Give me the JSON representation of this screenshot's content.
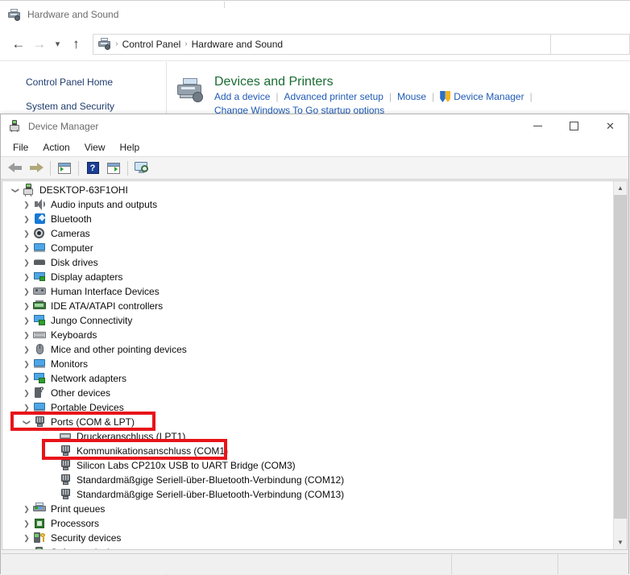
{
  "control_panel": {
    "title": "Hardware and Sound",
    "title_icon": "printer-icon",
    "nav": {
      "back_icon": "arrow-left-icon",
      "forward_icon": "arrow-right-icon",
      "recent_icon": "chevron-down-icon",
      "up_icon": "arrow-up-icon"
    },
    "breadcrumb": {
      "icon": "printer-icon",
      "items": [
        "Control Panel",
        "Hardware and Sound"
      ],
      "separator": "›"
    },
    "search_placeholder": "",
    "left_nav": [
      {
        "label": "Control Panel Home"
      },
      {
        "label": "System and Security"
      }
    ],
    "devices_and_printers": {
      "icon": "printer-icon",
      "heading": "Devices and Printers",
      "links": [
        {
          "label": "Add a device",
          "icon": null
        },
        {
          "label": "Advanced printer setup",
          "icon": null
        },
        {
          "label": "Mouse",
          "icon": null
        },
        {
          "label": "Device Manager",
          "icon": "shield-icon"
        }
      ],
      "extra_link": "Change Windows To Go startup options"
    }
  },
  "device_manager": {
    "title": "Device Manager",
    "title_icon": "device-manager-icon",
    "window_buttons": {
      "minimize": "—",
      "maximize": "□",
      "close": "✕"
    },
    "menu": [
      "File",
      "Action",
      "View",
      "Help"
    ],
    "toolbar": [
      {
        "name": "back-icon"
      },
      {
        "name": "forward-icon"
      },
      {
        "name": "properties-icon"
      },
      {
        "name": "help-icon"
      },
      {
        "name": "update-driver-icon"
      },
      {
        "name": "scan-hardware-changes-icon"
      }
    ],
    "tree": [
      {
        "label": "DESKTOP-63F1OHI",
        "level": 0,
        "twisty": "open",
        "icon": "computer-icon"
      },
      {
        "label": "Audio inputs and outputs",
        "level": 1,
        "twisty": "closed",
        "icon": "speaker-icon"
      },
      {
        "label": "Bluetooth",
        "level": 1,
        "twisty": "closed",
        "icon": "bluetooth-icon"
      },
      {
        "label": "Cameras",
        "level": 1,
        "twisty": "closed",
        "icon": "camera-icon"
      },
      {
        "label": "Computer",
        "level": 1,
        "twisty": "closed",
        "icon": "monitor-icon"
      },
      {
        "label": "Disk drives",
        "level": 1,
        "twisty": "closed",
        "icon": "disk-icon"
      },
      {
        "label": "Display adapters",
        "level": 1,
        "twisty": "closed",
        "icon": "display-adapter-icon"
      },
      {
        "label": "Human Interface Devices",
        "level": 1,
        "twisty": "closed",
        "icon": "hid-icon"
      },
      {
        "label": "IDE ATA/ATAPI controllers",
        "level": 1,
        "twisty": "closed",
        "icon": "ide-controller-icon"
      },
      {
        "label": "Jungo Connectivity",
        "level": 1,
        "twisty": "closed",
        "icon": "network-icon"
      },
      {
        "label": "Keyboards",
        "level": 1,
        "twisty": "closed",
        "icon": "keyboard-icon"
      },
      {
        "label": "Mice and other pointing devices",
        "level": 1,
        "twisty": "closed",
        "icon": "mouse-icon"
      },
      {
        "label": "Monitors",
        "level": 1,
        "twisty": "closed",
        "icon": "monitor-icon"
      },
      {
        "label": "Network adapters",
        "level": 1,
        "twisty": "closed",
        "icon": "network-icon"
      },
      {
        "label": "Other devices",
        "level": 1,
        "twisty": "closed",
        "icon": "other-device-icon"
      },
      {
        "label": "Portable Devices",
        "level": 1,
        "twisty": "closed",
        "icon": "monitor-icon"
      },
      {
        "label": "Ports (COM & LPT)",
        "level": 1,
        "twisty": "open",
        "icon": "port-icon",
        "highlighted": true
      },
      {
        "label": "Druckeranschluss (LPT1)",
        "level": 2,
        "twisty": "none",
        "icon": "lpt-port-icon"
      },
      {
        "label": "Kommunikationsanschluss (COM1)",
        "level": 2,
        "twisty": "none",
        "icon": "port-icon",
        "highlighted": true
      },
      {
        "label": "Silicon Labs CP210x USB to UART Bridge (COM3)",
        "level": 2,
        "twisty": "none",
        "icon": "port-icon"
      },
      {
        "label": "Standardmäßgige Seriell-über-Bluetooth-Verbindung (COM12)",
        "level": 2,
        "twisty": "none",
        "icon": "port-icon"
      },
      {
        "label": "Standardmäßgige Seriell-über-Bluetooth-Verbindung (COM13)",
        "level": 2,
        "twisty": "none",
        "icon": "port-icon"
      },
      {
        "label": "Print queues",
        "level": 1,
        "twisty": "closed",
        "icon": "print-queue-icon"
      },
      {
        "label": "Processors",
        "level": 1,
        "twisty": "closed",
        "icon": "processor-icon"
      },
      {
        "label": "Security devices",
        "level": 1,
        "twisty": "closed",
        "icon": "security-device-icon"
      },
      {
        "label": "Software devices",
        "level": 1,
        "twisty": "closed",
        "icon": "software-device-icon"
      }
    ],
    "scrollbar": {
      "up_arrow": "▲",
      "down_arrow": "▼"
    },
    "status_bar": [
      "",
      "",
      ""
    ]
  },
  "annotations": {
    "highlight_color": "#e8141a",
    "boxes": [
      {
        "name": "ports-highlight",
        "target": "Ports (COM & LPT)"
      },
      {
        "name": "com1-highlight",
        "target": "Kommunikationsanschluss (COM1)"
      }
    ]
  }
}
